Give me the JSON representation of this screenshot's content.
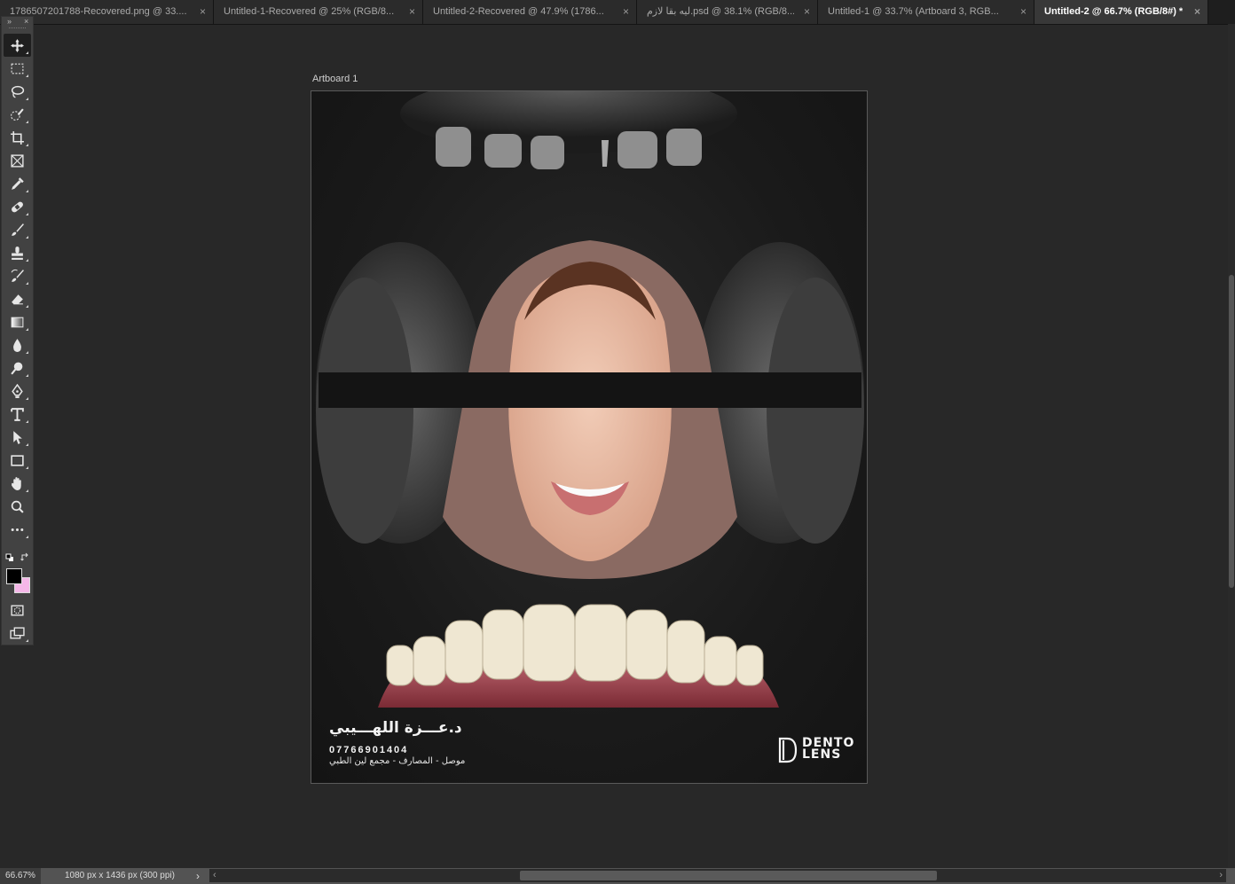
{
  "tabs": [
    {
      "label": "1786507201788-Recovered.png @ 33....",
      "active": false
    },
    {
      "label": "Untitled-1-Recovered @ 25% (RGB/8...",
      "active": false
    },
    {
      "label": "Untitled-2-Recovered @ 47.9% (1786...",
      "active": false
    },
    {
      "label": "ليه بقا لازم.psd @ 38.1% (RGB/8...",
      "active": false
    },
    {
      "label": "Untitled-1 @ 33.7% (Artboard 3, RGB...",
      "active": false
    },
    {
      "label": "Untitled-2 @ 66.7% (RGB/8#) *",
      "active": true
    }
  ],
  "tab_close_glyph": "×",
  "toolbar": {
    "collapse_glyph": "»",
    "close_glyph": "×",
    "tools": [
      {
        "name": "move-tool",
        "icon": "move-icon",
        "active": true
      },
      {
        "name": "marquee-tool",
        "icon": "rectangular-marquee-icon"
      },
      {
        "name": "lasso-tool",
        "icon": "lasso-icon"
      },
      {
        "name": "quick-selection-tool",
        "icon": "quick-selection-icon"
      },
      {
        "name": "crop-tool",
        "icon": "crop-icon"
      },
      {
        "name": "frame-tool",
        "icon": "frame-icon"
      },
      {
        "name": "eyedropper-tool",
        "icon": "eyedropper-icon"
      },
      {
        "name": "healing-brush-tool",
        "icon": "bandage-icon"
      },
      {
        "name": "brush-tool",
        "icon": "brush-icon"
      },
      {
        "name": "clone-stamp-tool",
        "icon": "stamp-icon"
      },
      {
        "name": "history-brush-tool",
        "icon": "history-brush-icon"
      },
      {
        "name": "eraser-tool",
        "icon": "eraser-icon"
      },
      {
        "name": "gradient-tool",
        "icon": "gradient-icon"
      },
      {
        "name": "blur-tool",
        "icon": "drop-icon"
      },
      {
        "name": "dodge-tool",
        "icon": "dodge-icon"
      },
      {
        "name": "pen-tool",
        "icon": "pen-icon"
      },
      {
        "name": "type-tool",
        "icon": "type-icon"
      },
      {
        "name": "path-selection-tool",
        "icon": "arrow-pointer-icon"
      },
      {
        "name": "rectangle-tool",
        "icon": "rectangle-icon"
      },
      {
        "name": "hand-tool",
        "icon": "hand-icon"
      },
      {
        "name": "zoom-tool",
        "icon": "magnifier-icon"
      },
      {
        "name": "edit-toolbar",
        "icon": "ellipsis-icon"
      }
    ],
    "foreground_color": "#000000",
    "background_color": "#f5b7e8"
  },
  "artboard": {
    "label": "Artboard 1",
    "doctor_name": "د.عـــزة اللهـــيبي",
    "phone": "07766901404",
    "address": "موصل - المصارف - مجمع لين الطبي",
    "logo_line1": "DENTO",
    "logo_line2": "LENS"
  },
  "status": {
    "zoom": "66.67%",
    "doc_info": "1080 px x 1436 px (300 ppi)",
    "arrow": "›"
  },
  "hscroll": {
    "left": "‹",
    "right": "›"
  }
}
